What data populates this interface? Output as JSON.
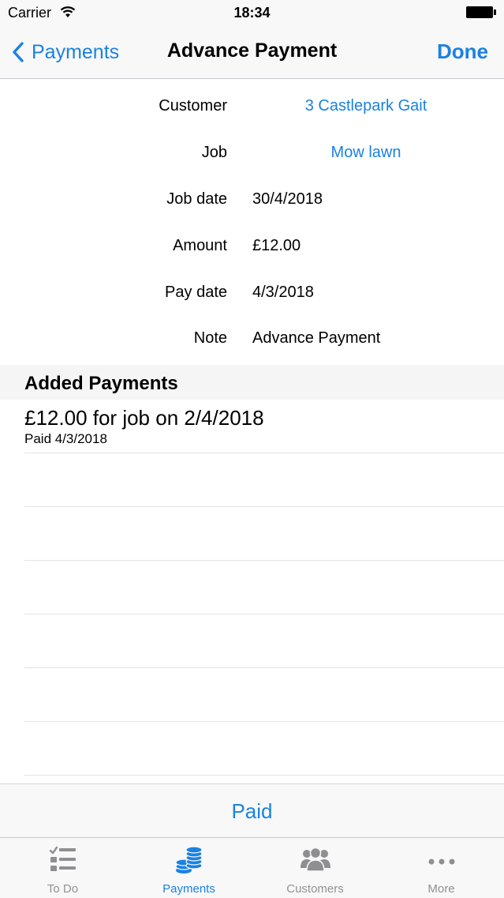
{
  "status_bar": {
    "carrier": "Carrier",
    "time": "18:34"
  },
  "nav": {
    "back_label": "Payments",
    "title": "Advance Payment",
    "done_label": "Done"
  },
  "form": {
    "customer": {
      "label": "Customer",
      "value": "3 Castlepark Gait"
    },
    "job": {
      "label": "Job",
      "value": "Mow lawn"
    },
    "job_date": {
      "label": "Job date",
      "value": "30/4/2018"
    },
    "amount": {
      "label": "Amount",
      "value": "£12.00"
    },
    "pay_date": {
      "label": "Pay date",
      "value": "4/3/2018"
    },
    "note": {
      "label": "Note",
      "value": "Advance Payment"
    }
  },
  "added_payments": {
    "header": "Added Payments",
    "items": [
      {
        "title": "£12.00 for job on 2/4/2018",
        "subtitle": "Paid 4/3/2018"
      }
    ]
  },
  "paid_button": "Paid",
  "tabs": [
    {
      "label": "To Do",
      "icon": "checklist-icon",
      "active": false
    },
    {
      "label": "Payments",
      "icon": "coins-icon",
      "active": true
    },
    {
      "label": "Customers",
      "icon": "people-icon",
      "active": false
    },
    {
      "label": "More",
      "icon": "more-icon",
      "active": false
    }
  ],
  "colors": {
    "accent": "#1a82e2",
    "inactive_tab": "#929292",
    "bar_background": "#f8f8f8"
  }
}
